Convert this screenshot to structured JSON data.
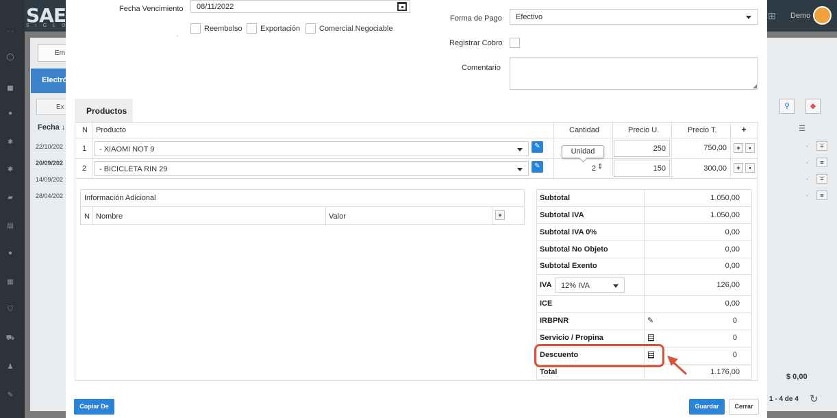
{
  "background": {
    "user_label": "Demo",
    "emit_button": "Em",
    "tab_label": "Electró",
    "export_button": "Ex",
    "fecha_col": "Fecha ↓",
    "rows": [
      "22/10/202",
      "20/09/202",
      "14/09/202",
      "28/04/202"
    ],
    "total": "$ 0,00",
    "pager": "1 - 4 de 4"
  },
  "form": {
    "fecha_vencimiento_label": "Fecha Vencimiento",
    "fecha_vencimiento_value": "08/11/2022",
    "reembolso_label": "Reembolso",
    "exportacion_label": "Exportación",
    "comercial_label": "Comercial Negociable",
    "forma_pago_label": "Forma de Pago",
    "forma_pago_value": "Efectivo",
    "registrar_cobro_label": "Registrar Cobro",
    "comentario_label": "Comentario"
  },
  "tab": {
    "label": "Productos"
  },
  "products_table": {
    "headers": {
      "n": "N",
      "producto": "Producto",
      "cantidad": "Cantidad",
      "precio_u": "Precio U.",
      "precio_t": "Precio T.",
      "add": "+"
    },
    "rows": [
      {
        "n": "1",
        "producto": "- XIAOMI NOT 9",
        "cantidad": "",
        "precio_u": "250",
        "precio_t": "750,00"
      },
      {
        "n": "2",
        "producto": "- BICICLETA RIN 29",
        "cantidad": "2",
        "precio_u": "150",
        "precio_t": "300,00"
      }
    ],
    "tooltip": "Unidad"
  },
  "info_adicional": {
    "title": "Información Adicional",
    "headers": {
      "n": "N",
      "nombre": "Nombre",
      "valor": "Valor",
      "add": "+"
    }
  },
  "summary": {
    "subtotal_label": "Subtotal",
    "subtotal": "1.050,00",
    "subtotal_iva_label": "Subtotal IVA",
    "subtotal_iva": "1.050,00",
    "subtotal_iva0_label": "Subtotal IVA 0%",
    "subtotal_iva0": "0,00",
    "subtotal_no_objeto_label": "Subtotal No Objeto",
    "subtotal_no_objeto": "0,00",
    "subtotal_exento_label": "Subtotal Exento",
    "subtotal_exento": "0,00",
    "iva_label": "IVA",
    "iva_select": "12% IVA",
    "iva": "126,00",
    "ice_label": "ICE",
    "ice": "0,00",
    "irbpnr_label": "IRBPNR",
    "irbpnr": "0",
    "servicio_label": "Servicio / Propina",
    "servicio": "0",
    "descuento_label": "Descuento",
    "descuento": "0",
    "total_label": "Total",
    "total": "1.176,00"
  },
  "footer": {
    "copiar_label": "Copiar De",
    "guardar_label": "Guardar",
    "cerrar_label": "Cerrar"
  },
  "colors": {
    "primary": "#2a83d6",
    "highlight": "#d9533a"
  }
}
